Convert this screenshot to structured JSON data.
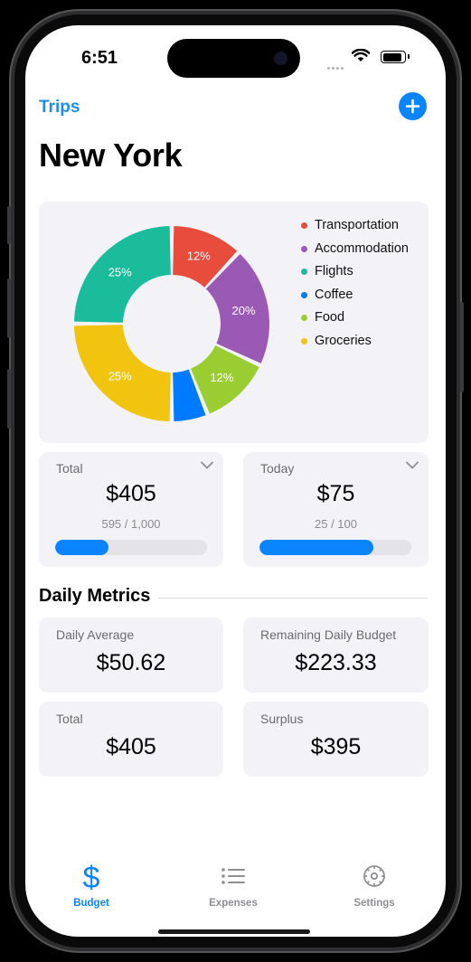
{
  "status_bar": {
    "time": "6:51"
  },
  "nav": {
    "back_label": "Trips",
    "title": "New York"
  },
  "chart_data": {
    "type": "pie",
    "categories": [
      "Transportation",
      "Accommodation",
      "Flights",
      "Coffee",
      "Food",
      "Groceries"
    ],
    "colors": [
      "#e74c3c",
      "#9b59b6",
      "#1abc9c",
      "#007aff",
      "#9acd32",
      "#f1c40f"
    ],
    "slices": [
      {
        "name": "Transportation",
        "value": 12,
        "label": "12%",
        "color": "#e74c3c"
      },
      {
        "name": "Accommodation",
        "value": 20,
        "label": "20%",
        "color": "#9b59b6"
      },
      {
        "name": "Food",
        "value": 12,
        "label": "12%",
        "color": "#9acd32"
      },
      {
        "name": "Coffee",
        "value": 6,
        "label": "",
        "color": "#007aff"
      },
      {
        "name": "Groceries",
        "value": 25,
        "label": "25%",
        "color": "#f1c40f"
      },
      {
        "name": "Flights",
        "value": 25,
        "label": "25%",
        "color": "#1abc9c"
      }
    ],
    "donut": true,
    "legend_position": "right"
  },
  "summary": {
    "total": {
      "label": "Total",
      "amount": "$405",
      "progress_text": "595 / 1,000",
      "progress": 0.35
    },
    "today": {
      "label": "Today",
      "amount": "$75",
      "progress_text": "25 / 100",
      "progress": 0.75
    }
  },
  "daily_metrics": {
    "heading": "Daily Metrics",
    "items": [
      {
        "label": "Daily Average",
        "value": "$50.62"
      },
      {
        "label": "Remaining Daily Budget",
        "value": "$223.33"
      },
      {
        "label": "Total",
        "value": "$405"
      },
      {
        "label": "Surplus",
        "value": "$395"
      }
    ]
  },
  "tabs": [
    {
      "label": "Budget",
      "icon": "dollar-icon",
      "active": true
    },
    {
      "label": "Expenses",
      "icon": "list-icon",
      "active": false
    },
    {
      "label": "Settings",
      "icon": "gear-icon",
      "active": false
    }
  ],
  "colors": {
    "accent": "#0a84ff",
    "card_bg": "#f2f2f7",
    "inactive": "#8e8e93"
  }
}
